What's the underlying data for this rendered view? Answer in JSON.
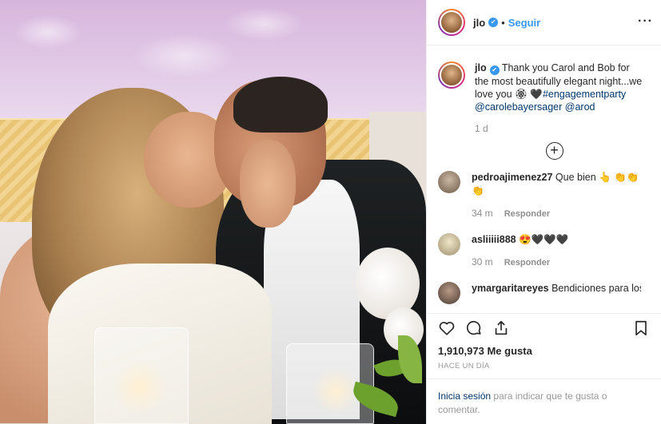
{
  "header": {
    "username": "jlo",
    "verified_mark": "✔",
    "dot": "•",
    "follow_label": "Seguir",
    "more_label": "···"
  },
  "caption": {
    "username": "jlo",
    "text_before": " Thank you Carol and Bob for the most beautifully elegant night...we love you 🏵 🖤",
    "hashtag": "#engagementparty",
    "mention1": "@carolebayersager",
    "mention2": "@arod",
    "time": "1 d",
    "load_more": "+"
  },
  "comments": [
    {
      "username": "pedroajimenez27",
      "text": " Que bien 👆 👏👏👏",
      "time": "34 m",
      "reply": "Responder"
    },
    {
      "username": "asliiiii888",
      "text": " 😍🖤🖤🖤",
      "time": "30 m",
      "reply": "Responder"
    },
    {
      "username": "ymargaritareyes",
      "text": " Bendiciones para los"
    }
  ],
  "likes": {
    "count": "1,910,973",
    "label": "Me gusta"
  },
  "posted_ago": "HACE UN DÍA",
  "login": {
    "link": "Inicia sesión",
    "text": " para indicar que te gusta o comentar."
  },
  "icons": [
    "heart-icon",
    "comment-icon",
    "share-icon",
    "bookmark-icon",
    "plus-circle-icon",
    "more-icon",
    "verified-badge-icon"
  ],
  "colors": {
    "link_blue": "#3897f0",
    "tag_navy": "#003569",
    "text": "#262626",
    "muted": "#8e8e8e"
  }
}
